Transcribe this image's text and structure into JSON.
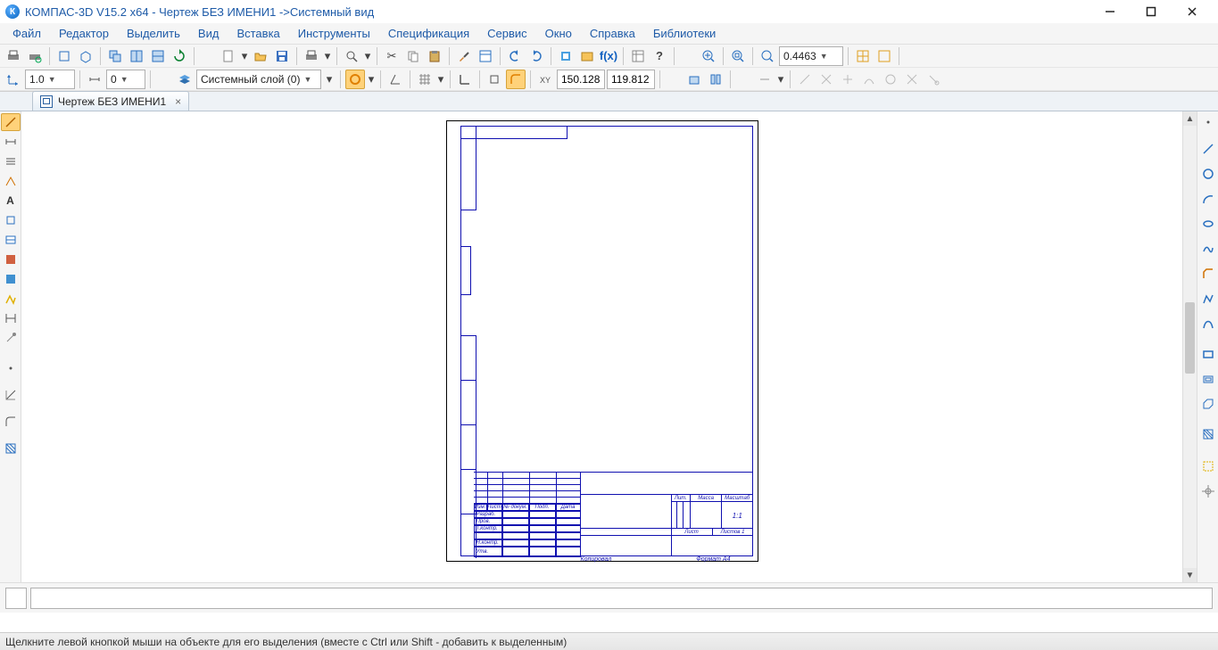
{
  "app": {
    "title": "КОМПАС-3D V15.2  x64 - Чертеж БЕЗ ИМЕНИ1 ->Системный вид",
    "icon_letter": "К"
  },
  "menu": {
    "items": [
      "Файл",
      "Редактор",
      "Выделить",
      "Вид",
      "Вставка",
      "Инструменты",
      "Спецификация",
      "Сервис",
      "Окно",
      "Справка",
      "Библиотеки"
    ]
  },
  "toolbar1": {
    "zoom_value": "0.4463"
  },
  "toolbar2": {
    "scale": "1.0",
    "step": "0",
    "layer_label": "Системный слой (0)",
    "coord_x": "150.128",
    "coord_y": "119.812"
  },
  "doc_tabs": {
    "tab1_name": "Чертеж БЕЗ ИМЕНИ1"
  },
  "title_block": {
    "lit": "Лит.",
    "massa": "Масса",
    "mashtab": "Масштаб",
    "scale_val": "1:1",
    "list": "Лист",
    "listov": "Листов  1",
    "kopiroval": "Копировал",
    "format": "Формат   A4",
    "izm": "Изм.",
    "list2": "Лист",
    "ndokum": "№ докум.",
    "podp": "Подп.",
    "data": "Дата",
    "razrab": "Разраб.",
    "prov": "Пров.",
    "tkontr": "Т.контр.",
    "nkontr": "Н.контр.",
    "utv": "Утв."
  },
  "statusbar": {
    "hint": "Щелкните левой кнопкой мыши на объекте для его выделения (вместе с Ctrl или Shift - добавить к выделенным)"
  }
}
